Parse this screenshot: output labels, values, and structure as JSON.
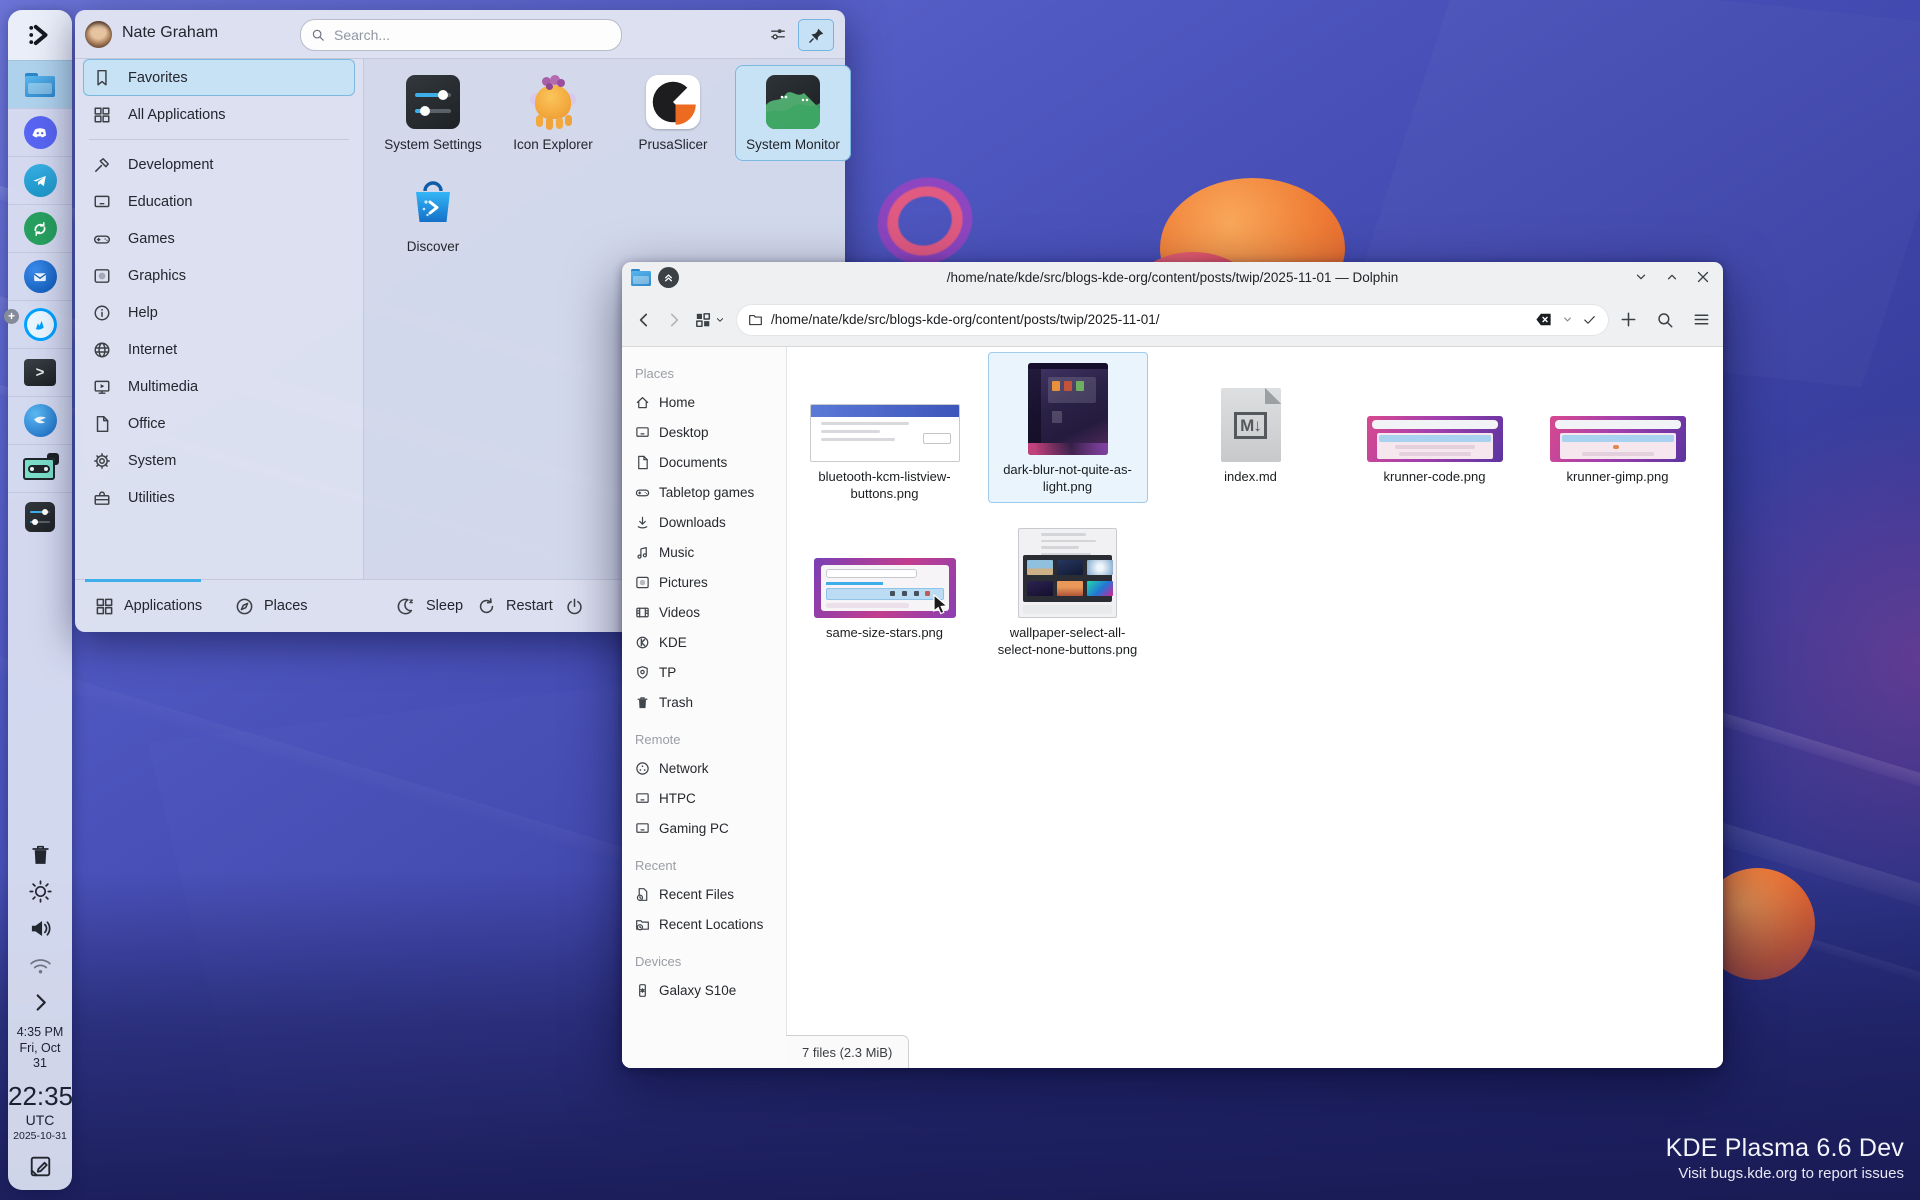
{
  "colors": {
    "accent": "#3daee9",
    "selection_fill": "#c8e2f5",
    "selection_border": "#7db8e0"
  },
  "desktop": {
    "version": "KDE Plasma 6.6 Dev",
    "report": "Visit bugs.kde.org to report issues"
  },
  "panel": {
    "launcher_icon": "kde-plasma-dev-logo",
    "tasks": [
      "dolphin-file-manager",
      "discord",
      "telegram",
      "sync-app",
      "thunderbird",
      "librewolf",
      "konsole",
      "blue-bird-app",
      "cassette-player",
      "system-settings"
    ],
    "tray_icons": [
      "trash",
      "brightness",
      "volume",
      "network",
      "expand-chevron"
    ],
    "clock": {
      "local_time": "4:35 PM",
      "local_date_line1": "Fri, Oct",
      "local_date_line2": "31",
      "utc_time": "22:35",
      "utc_zone": "UTC",
      "utc_date": "2025-10-31"
    },
    "note_icon": "sticky-note"
  },
  "launcher": {
    "user": "Nate Graham",
    "search_placeholder": "Search...",
    "header_icons": [
      "configure",
      "pin"
    ],
    "sidebar": [
      {
        "label": "Favorites",
        "icon": "bookmark",
        "selected": true
      },
      {
        "label": "All Applications",
        "icon": "grid",
        "selected": false
      },
      {
        "label": "Development",
        "icon": "hammer",
        "selected": false
      },
      {
        "label": "Education",
        "icon": "screen",
        "selected": false
      },
      {
        "label": "Games",
        "icon": "gamepad",
        "selected": false
      },
      {
        "label": "Graphics",
        "icon": "image",
        "selected": false
      },
      {
        "label": "Help",
        "icon": "info",
        "selected": false
      },
      {
        "label": "Internet",
        "icon": "globe",
        "selected": false
      },
      {
        "label": "Multimedia",
        "icon": "media-screen",
        "selected": false
      },
      {
        "label": "Office",
        "icon": "document",
        "selected": false
      },
      {
        "label": "System",
        "icon": "gear",
        "selected": false
      },
      {
        "label": "Utilities",
        "icon": "toolbox",
        "selected": false
      }
    ],
    "apps": [
      {
        "label": "System Settings",
        "selected": false
      },
      {
        "label": "Icon Explorer",
        "selected": false
      },
      {
        "label": "PrusaSlicer",
        "selected": false
      },
      {
        "label": "System Monitor",
        "selected": true
      },
      {
        "label": "Discover",
        "selected": false
      }
    ],
    "tabs": [
      {
        "label": "Applications",
        "icon": "grid",
        "active": true
      },
      {
        "label": "Places",
        "icon": "compass",
        "active": false
      }
    ],
    "actions": [
      {
        "label": "Sleep",
        "icon": "moon"
      },
      {
        "label": "Restart",
        "icon": "restart"
      },
      {
        "label": "",
        "icon": "power"
      }
    ]
  },
  "dolphin": {
    "title": "/home/nate/kde/src/blogs-kde-org/content/posts/twip/2025-11-01 — Dolphin",
    "path": "/home/nate/kde/src/blogs-kde-org/content/posts/twip/2025-11-01/",
    "sections": [
      {
        "title": "Places",
        "items": [
          "Home",
          "Desktop",
          "Documents",
          "Tabletop games",
          "Downloads",
          "Music",
          "Pictures",
          "Videos",
          "KDE",
          "TP",
          "Trash"
        ]
      },
      {
        "title": "Remote",
        "items": [
          "Network",
          "HTPC",
          "Gaming PC"
        ]
      },
      {
        "title": "Recent",
        "items": [
          "Recent Files",
          "Recent Locations"
        ]
      },
      {
        "title": "Devices",
        "items": [
          "Galaxy S10e"
        ]
      }
    ],
    "files": [
      {
        "name": "bluetooth-kcm-listview-buttons.png",
        "selected": false
      },
      {
        "name": "dark-blur-not-quite-as-light.png",
        "selected": true
      },
      {
        "name": "index.md",
        "selected": false
      },
      {
        "name": "krunner-code.png",
        "selected": false
      },
      {
        "name": "krunner-gimp.png",
        "selected": false
      },
      {
        "name": "same-size-stars.png",
        "selected": false
      },
      {
        "name": "wallpaper-select-all-select-none-buttons.png",
        "selected": false
      }
    ],
    "status": "7 files (2.3 MiB)"
  }
}
